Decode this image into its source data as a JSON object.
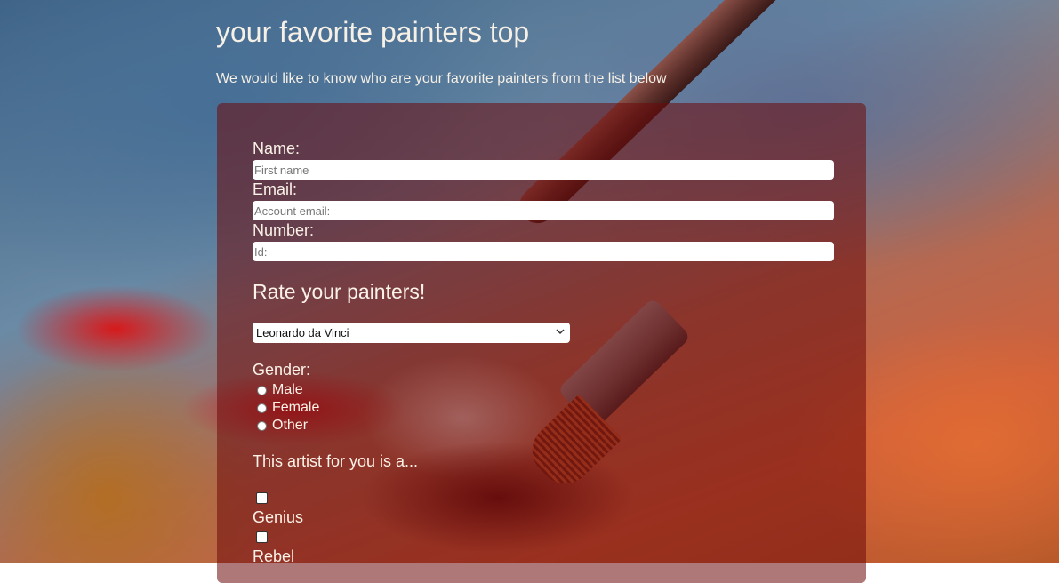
{
  "header": {
    "title": "your favorite painters top",
    "subtitle": "We would like to know who are your favorite painters from the list below"
  },
  "form": {
    "name_label": "Name:",
    "name_placeholder": "First name",
    "email_label": "Email:",
    "email_placeholder": "Account email:",
    "number_label": "Number:",
    "number_placeholder": "Id:",
    "rate_heading": "Rate your painters!",
    "painter_select": {
      "selected": "Leonardo da Vinci"
    },
    "gender_label": "Gender:",
    "gender_options": [
      "Male",
      "Female",
      "Other"
    ],
    "artist_heading": "This artist for you is a...",
    "artist_options": [
      "Genius",
      "Rebel"
    ]
  },
  "colors": {
    "card_background": "#6e0a0a",
    "text": "#fbf2e8"
  },
  "icons": {
    "select_arrow": "chevron-down-icon"
  }
}
